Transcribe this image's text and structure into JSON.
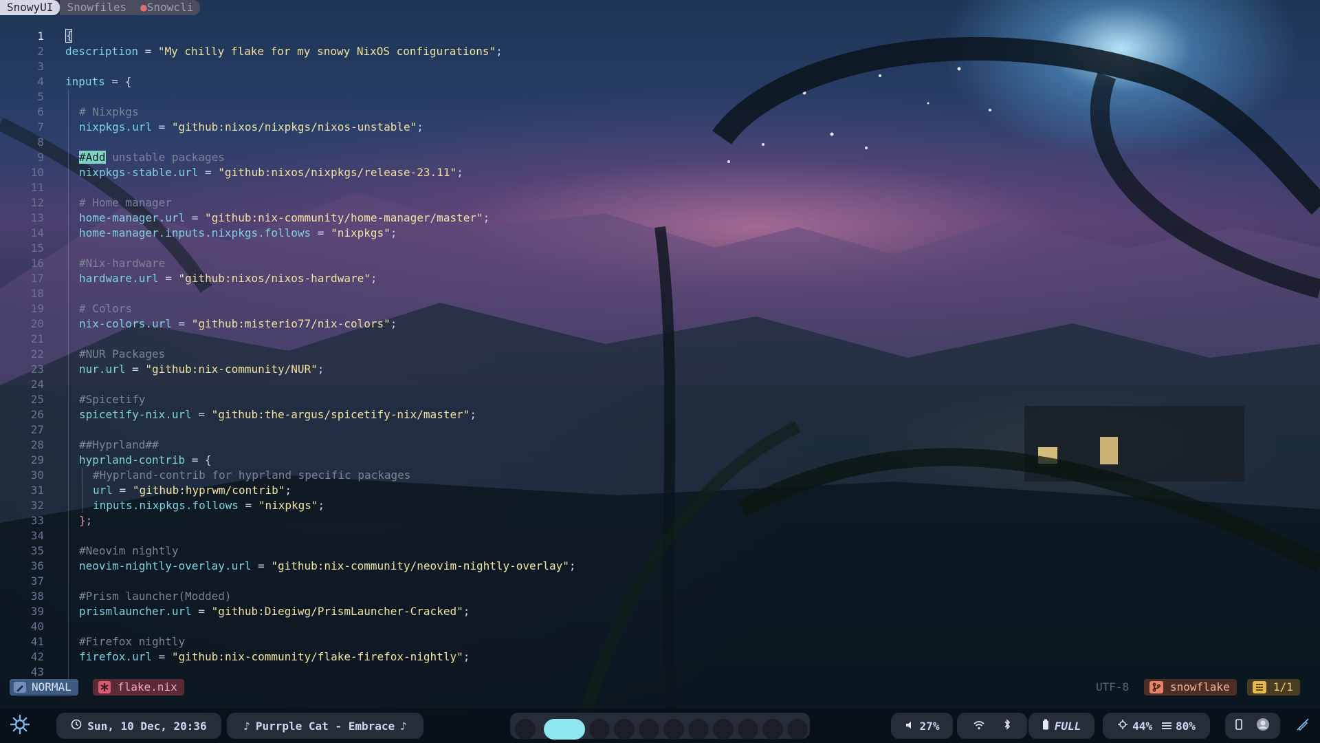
{
  "tabs": [
    {
      "label": "SnowyUI"
    },
    {
      "label": "Snowfiles"
    },
    {
      "label": "Snowcli",
      "dot": "●"
    }
  ],
  "editor": {
    "line_numbers": [
      "1",
      "2",
      "3",
      "4",
      "5",
      "6",
      "7",
      "8",
      "9",
      "10",
      "11",
      "12",
      "13",
      "14",
      "15",
      "16",
      "17",
      "18",
      "19",
      "20",
      "21",
      "22",
      "23",
      "24",
      "25",
      "26",
      "27",
      "28",
      "29",
      "30",
      "31",
      "32",
      "33",
      "34",
      "35",
      "36",
      "37",
      "38",
      "39",
      "40",
      "41",
      "42",
      "43"
    ],
    "cursor_char": "{",
    "l2": {
      "key": "description",
      "eq": " = ",
      "val": "\"My chilly flake for my snowy NixOS configurations\"",
      "semi": ";"
    },
    "l4": {
      "key": "inputs",
      "eq": " = {"
    },
    "l6": "# Nixpkgs",
    "l7": {
      "key": "nixpkgs.url",
      "eq": " = ",
      "val": "\"github:nixos/nixpkgs/nixos-unstable\"",
      "semi": ";"
    },
    "l9": {
      "hl": "#Add",
      "rest": " unstable packages"
    },
    "l10": {
      "key": "nixpkgs-stable.url",
      "eq": " = ",
      "val": "\"github:nixos/nixpkgs/release-23.11\"",
      "semi": ";"
    },
    "l12": "# Home manager",
    "l13": {
      "key": "home-manager.url",
      "eq": " = ",
      "val": "\"github:nix-community/home-manager/master\"",
      "semi": ";"
    },
    "l14": {
      "key": "home-manager.inputs.nixpkgs.follows",
      "eq": " = ",
      "val": "\"nixpkgs\"",
      "semi": ";"
    },
    "l16": "#Nix-hardware",
    "l17": {
      "key": "hardware.url",
      "eq": " = ",
      "val": "\"github:nixos/nixos-hardware\"",
      "semi": ";"
    },
    "l19": "# Colors",
    "l20": {
      "key": "nix-colors.url",
      "eq": " = ",
      "val": "\"github:misterio77/nix-colors\"",
      "semi": ";"
    },
    "l22": "#NUR Packages",
    "l23": {
      "key": "nur.url",
      "eq": " = ",
      "val": "\"github:nix-community/NUR\"",
      "semi": ";"
    },
    "l25": "#Spicetify",
    "l26": {
      "key": "spicetify-nix.url",
      "eq": " = ",
      "val": "\"github:the-argus/spicetify-nix/master\"",
      "semi": ";"
    },
    "l28": "##Hyprland##",
    "l29": {
      "key": "hyprland-contrib",
      "eq": " = {"
    },
    "l30": "#Hyprland-contrib for hyprland specific packages",
    "l31": {
      "key": "url",
      "eq": " = ",
      "val": "\"github:hyprwm/contrib\"",
      "semi": ";"
    },
    "l32": {
      "key": "inputs.nixpkgs.follows",
      "eq": " = ",
      "val": "\"nixpkgs\"",
      "semi": ";"
    },
    "l33": "};",
    "l35": "#Neovim nightly",
    "l36": {
      "key": "neovim-nightly-overlay.url",
      "eq": " = ",
      "val": "\"github:nix-community/neovim-nightly-overlay\"",
      "semi": ";"
    },
    "l38": "#Prism launcher(Modded)",
    "l39": {
      "key": "prismlauncher.url",
      "eq": " = ",
      "val": "\"github:Diegiwg/PrismLauncher-Cracked\"",
      "semi": ";"
    },
    "l41": "#Firefox nightly",
    "l42": {
      "key": "firefox.url",
      "eq": " = ",
      "val": "\"github:nix-community/flake-firefox-nightly\"",
      "semi": ";"
    }
  },
  "statusline": {
    "mode": "NORMAL",
    "file": "flake.nix",
    "encoding": "UTF-8",
    "branch": "snowflake",
    "position": "1/1"
  },
  "bar": {
    "datetime": "Sun, 10 Dec, 20:36",
    "music": "Purrple Cat - Embrace",
    "workspaces_total": 11,
    "workspace_active": 2,
    "volume": "27%",
    "battery": "FULL",
    "cpu": "44%",
    "memory": "80%"
  },
  "icons": [
    "settings-gear-icon",
    "clock-icon",
    "music-note-icon",
    "volume-icon",
    "wifi-icon",
    "bluetooth-icon",
    "battery-icon",
    "cpu-icon",
    "memory-icon",
    "phone-icon",
    "avatar-icon",
    "pen-icon",
    "nix-icon",
    "git-branch-icon",
    "lines-icon"
  ],
  "colors": {
    "accent": "#8fe7f2",
    "string": "#f1e2a0",
    "keyword": "#7fd3e0",
    "comment": "#7d8497"
  }
}
